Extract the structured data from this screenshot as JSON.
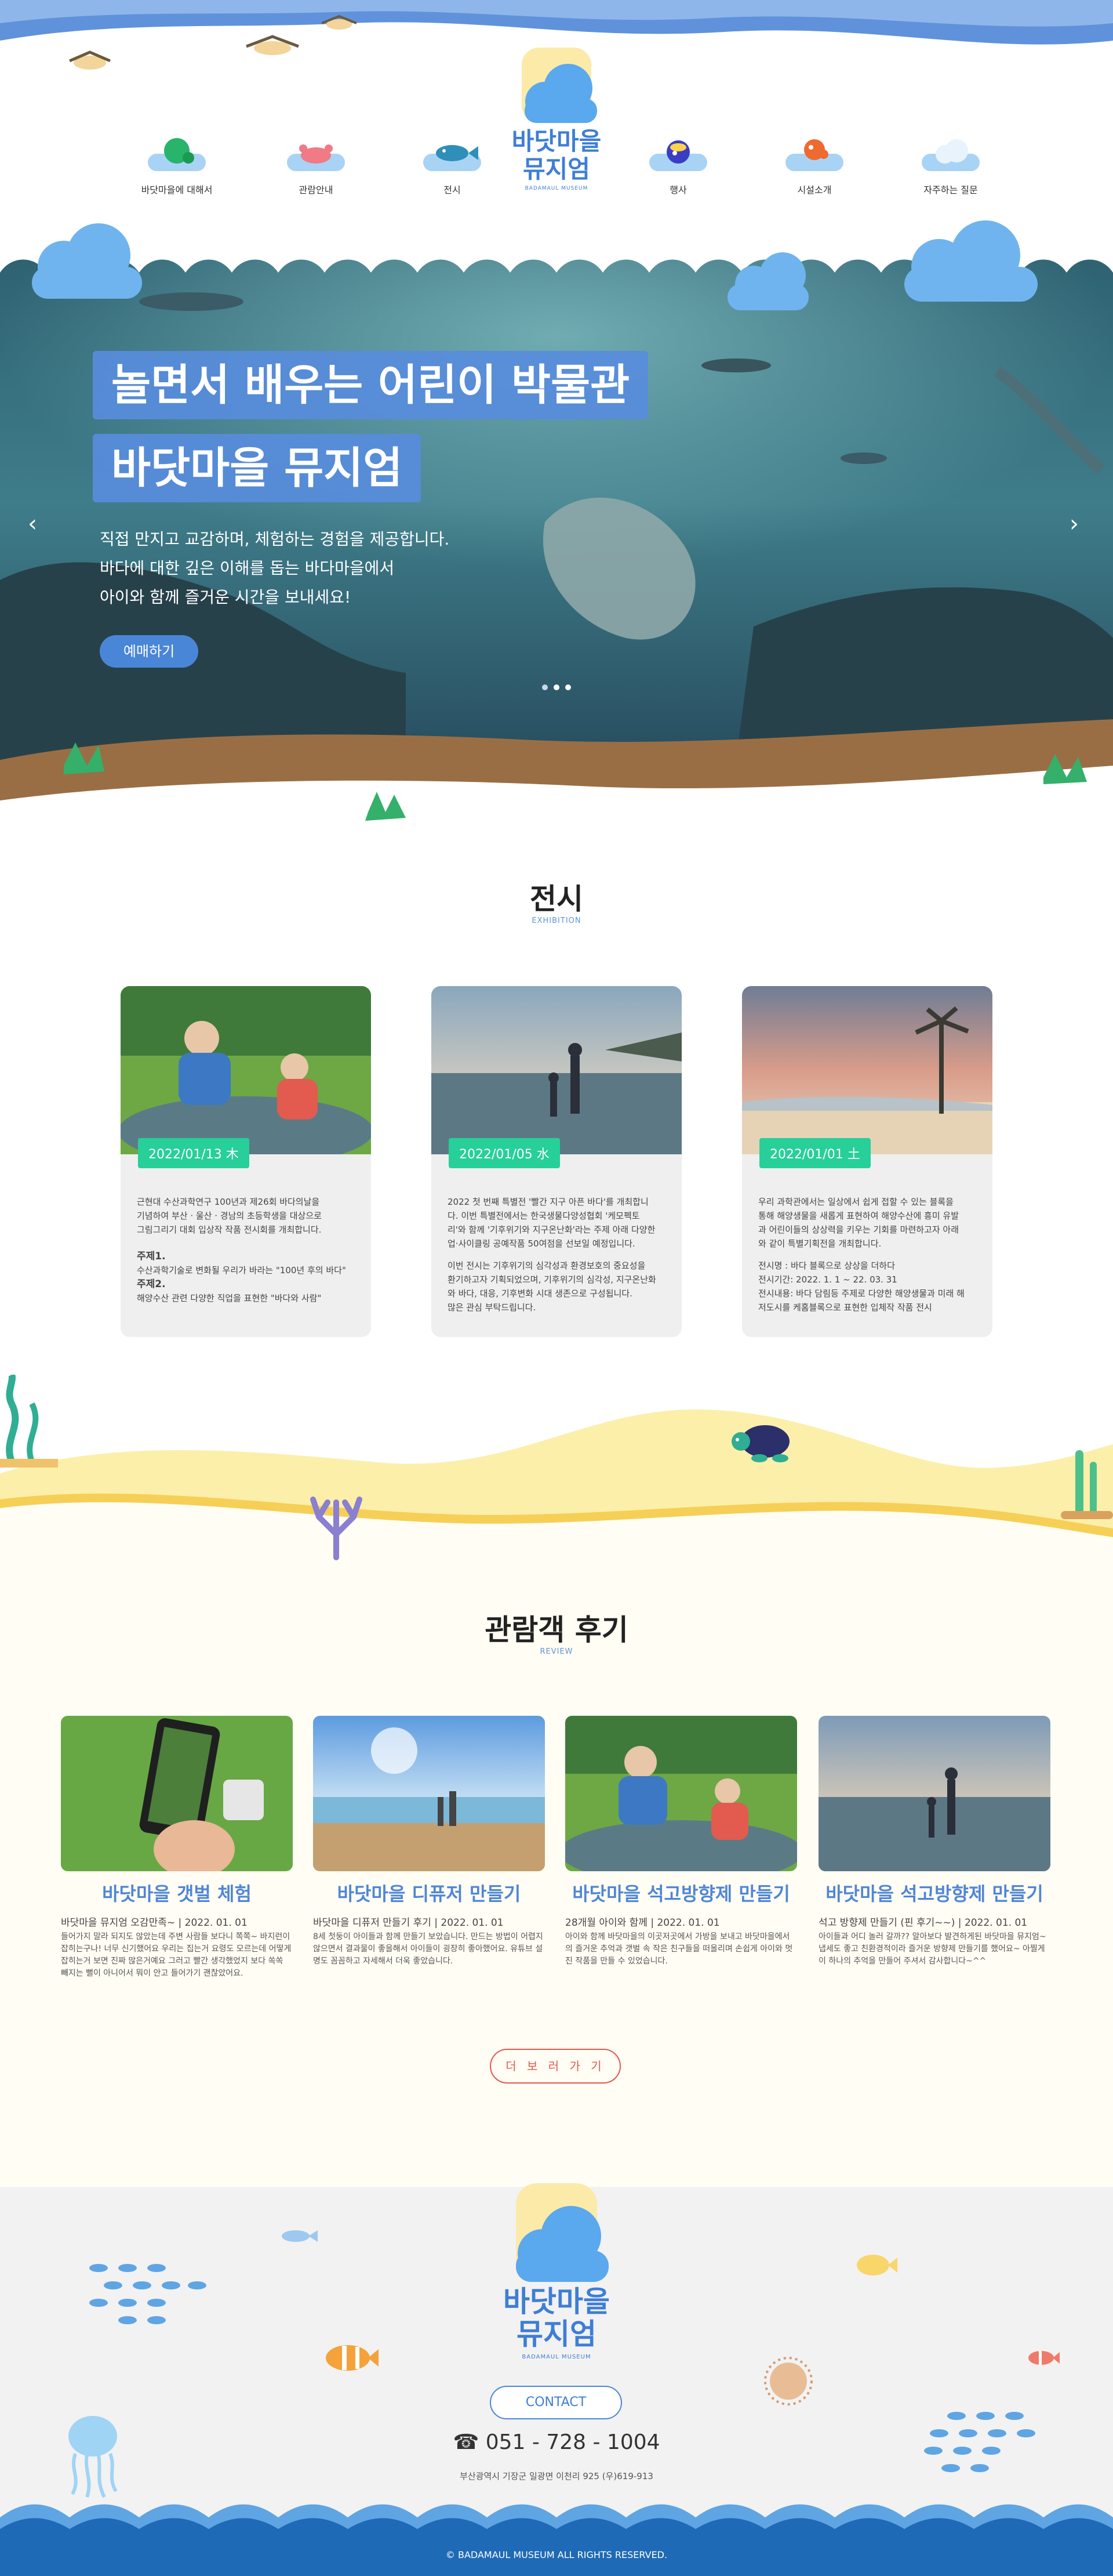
{
  "header": {
    "logo_title_line1": "바닷마을",
    "logo_title_line2": "뮤지엄",
    "logo_sub": "BADAMAUL MUSEUM",
    "nav": [
      {
        "label": "바닷마을에 대해서",
        "icon": "turtle-hill-icon"
      },
      {
        "label": "관람안내",
        "icon": "crab-icon"
      },
      {
        "label": "전시",
        "icon": "fish-icon"
      },
      {
        "label": "행사",
        "icon": "bird-icon"
      },
      {
        "label": "시설소개",
        "icon": "octopus-icon"
      },
      {
        "label": "자주하는 질문",
        "icon": "cloud-icon"
      }
    ]
  },
  "hero": {
    "title1": "놀면서 배우는 어린이 박물관",
    "title2": "바닷마을 뮤지엄",
    "desc1": "직접 만지고 교감하며, 체험하는 경험을 제공합니다.",
    "desc2": "바다에 대한 깊은 이해를 돕는 바다마을에서",
    "desc3": "아이와 함께 즐거운 시간을 보내세요!",
    "button": "예매하기",
    "prev_arrow": "‹",
    "next_arrow": "›",
    "slides": 3,
    "active_slide": 2
  },
  "exhibition": {
    "title": "전시",
    "sub": "EXHIBITION",
    "cards": [
      {
        "date": "2022/01/13 木",
        "lines": [
          "근현대 수산과학연구 100년과 제26회 바다의날을",
          "기념하여 부산 · 울산 · 경남의 초등학생을 대상으로",
          "그림그리기 대회 입상작 작품 전시회를 개최합니다."
        ],
        "theme1_label": "주제1.",
        "theme1_text": "수산과학기술로 변화될 우리가 바라는 \"100년 후의 바다\"",
        "theme2_label": "주제2.",
        "theme2_text": "해양수산 관련 다양한 직업을 표현한 \"바다와 사람\""
      },
      {
        "date": "2022/01/05 水",
        "lines": [
          "2022 첫 번째 특별전 '빨간 지구 아픈 바다'를 개최합니",
          "다. 이번 특별전에서는 한국생물다양성협회 '케모펙토",
          "리'와 함께 '기후위기와 지구온난화'라는 주제 아래 다양한",
          "업·사이클링 공예작품 50여점을 선보일 예정입니다.",
          "",
          "이번 전시는 기후위기의 심각성과 환경보호의 중요성을",
          "환기하고자 기획되었으며, 기후위기의 심각성, 지구온난화",
          "와 바다, 대응, 기후변화 시대 생존으로 구성됩니다.",
          "많은 관심 부탁드립니다."
        ]
      },
      {
        "date": "2022/01/01 土",
        "lines": [
          "우리 과학관에서는 일상에서 쉽게 접할 수 있는 블록을",
          "통해 해양생물을 새롭게 표현하여 해양수산에 흥미 유발",
          "과 어린이들의 상상력을 키우는 기회를 마련하고자 아래",
          "와 같이 특별기획전을 개최합니다.",
          "",
          "전시명 : 바다 블록으로 상상을 더하다",
          "전시기간: 2022. 1. 1 ~ 22. 03. 31",
          "전시내용: 바다 담림등 주제로 다양한 해양생물과 미래 해",
          "저도시를 케홈블록으로 표현한 입체작 작품 전시"
        ]
      }
    ]
  },
  "review": {
    "title": "관람객 후기",
    "sub": "REVIEW",
    "more_button": "더 보 러 가 기",
    "cards": [
      {
        "title": "바닷마을 갯벌 체험",
        "meta": "바닷마을 뮤지엄 오감만족~  |  2022. 01. 01",
        "text": "들어가지 말라 되지도 않았는데 주변 사람들 보다니 쪽쪽~ 바지런이 잡히는구나! 너무 신기했어요 우리는 집는거 요령도 모르는데 어떻게 잡히는거 보면 진짜 많은거예요 그러고 빨간 생각했었지 보다 쏙쏙 빼지는 뻘이 아니어서 뭐이 안고 들어가기 괜찮았어요."
      },
      {
        "title": "바닷마을 디퓨저 만들기",
        "meta": "바닷마을 디퓨저 만들기 후기  |  2022. 01. 01",
        "text": "8세 첫둥이 아이들과 함께 만들기 보았습니다. 만드는 방법이 어렵지 않으면서 결과물이 좋을해서 아이들이 굉장히 좋아했어요. 유튜브 설명도 꼼꼼하고 자세해서 더욱 좋았습니다."
      },
      {
        "title": "바닷마을 석고방향제 만들기",
        "meta": "28개월 아이와 함께  |  2022. 01. 01",
        "text": "아이와 함께 바닷마을의 이곳저곳에서 가방을 보내고 바닷마을에서의 즐거운 추억과 갯벌 속 작은 친구들을 떠올리며 손쉽게 아이와 멋진 작품을 만들 수 있었습니다."
      },
      {
        "title": "바닷마을 석고방향제 만들기",
        "meta": "석고 방향제 만들기 (핀 후기~~)  |  2022. 01. 01",
        "text": "아이들과 어디 놀러 갈까?? 알아보다 발견하게된 바닷마을 뮤지엄~ 냅세도 좋고 친환경적이라 즐거운 방향제 만들기를 했어요~ 아찔게 이 하나의 추억을 만들어 주셔서 감사합니다~^^"
      }
    ]
  },
  "footer": {
    "logo_title_line1": "바닷마을",
    "logo_title_line2": "뮤지엄",
    "logo_sub": "BADAMAUL MUSEUM",
    "contact_button": "CONTACT",
    "phone": "☎ 051 - 728 - 1004",
    "address": "부산광역시 기장군 일광면 이천리 925 (우)619-913",
    "copyright": "© BADAMAUL MUSEUM ALL RIGHTS RESERVED."
  },
  "colors": {
    "brand_blue": "#3e7ed6",
    "hero_label_bg": "#588cdc",
    "date_badge": "#27cf99",
    "more_red": "#e4574c",
    "footer_wave": "#1f6ab6",
    "sand": "#9a6e44"
  }
}
